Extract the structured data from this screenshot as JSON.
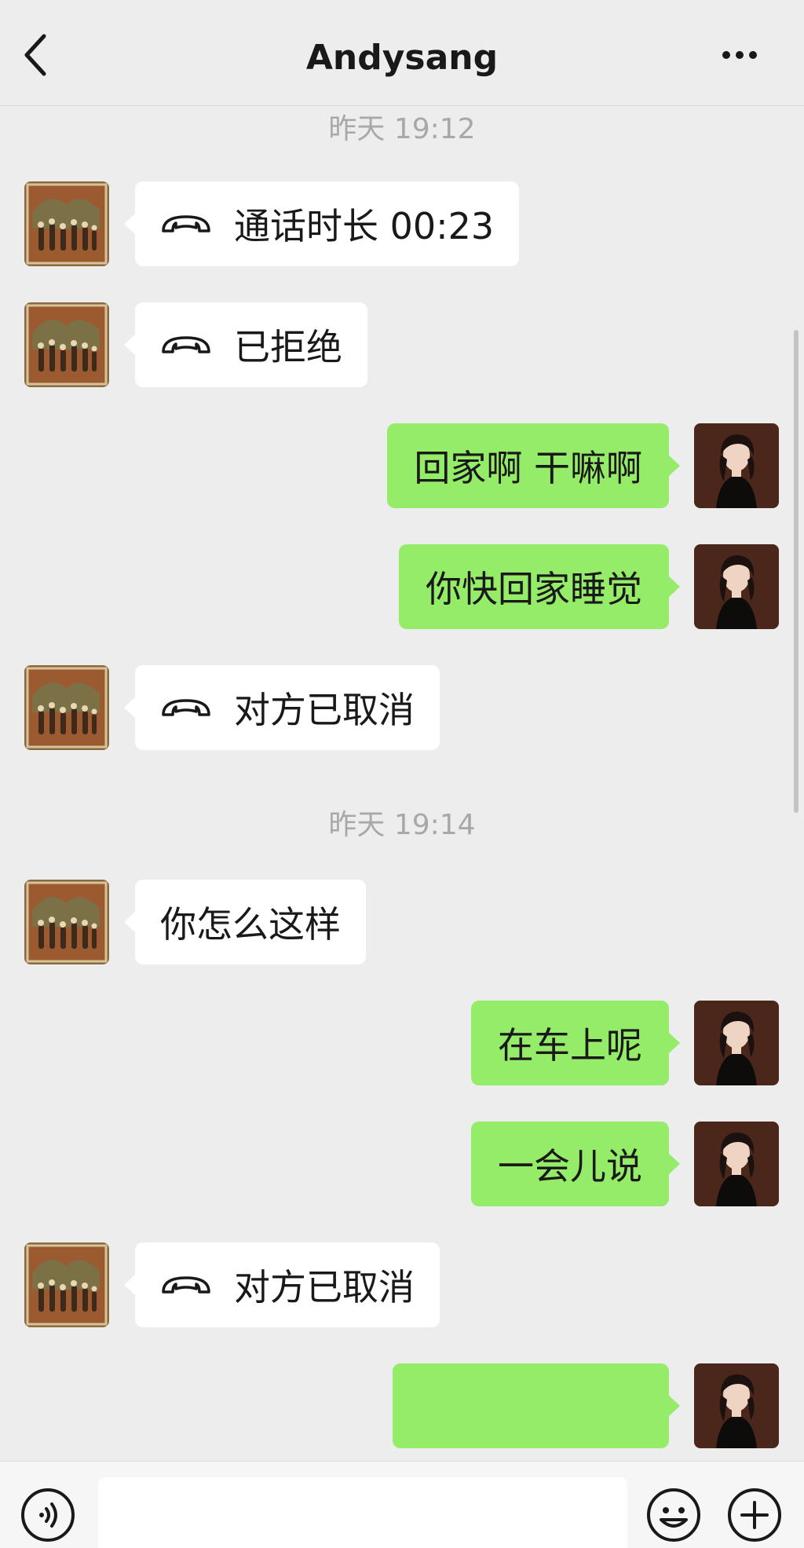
{
  "header": {
    "title": "Andysang",
    "back_icon": "chevron-left-icon",
    "more_icon": "more-dots-icon"
  },
  "messages": [
    {
      "type": "timestamp",
      "text": "昨天 19:12"
    },
    {
      "type": "call",
      "side": "left",
      "text": "通话时长 00:23",
      "icon": "phone-hangup-icon"
    },
    {
      "type": "call",
      "side": "left",
      "text": "已拒绝",
      "icon": "phone-hangup-icon"
    },
    {
      "type": "text",
      "side": "right",
      "text": "回家啊 干嘛啊"
    },
    {
      "type": "text",
      "side": "right",
      "text": "你快回家睡觉"
    },
    {
      "type": "call",
      "side": "left",
      "text": "对方已取消",
      "icon": "phone-hangup-icon"
    },
    {
      "type": "timestamp",
      "text": "昨天 19:14"
    },
    {
      "type": "text",
      "side": "left",
      "text": "你怎么这样"
    },
    {
      "type": "text",
      "side": "right",
      "text": "在车上呢"
    },
    {
      "type": "text",
      "side": "right",
      "text": "一会儿说"
    },
    {
      "type": "call",
      "side": "left",
      "text": "对方已取消",
      "icon": "phone-hangup-icon"
    },
    {
      "type": "text",
      "side": "right",
      "text": ""
    }
  ],
  "input_bar": {
    "voice_icon": "voice-icon",
    "emoji_icon": "emoji-icon",
    "plus_icon": "plus-icon",
    "input_value": ""
  },
  "colors": {
    "background": "#ededed",
    "sent_bubble": "#95ec69",
    "received_bubble": "#ffffff",
    "timestamp_text": "#a8a8a8"
  }
}
